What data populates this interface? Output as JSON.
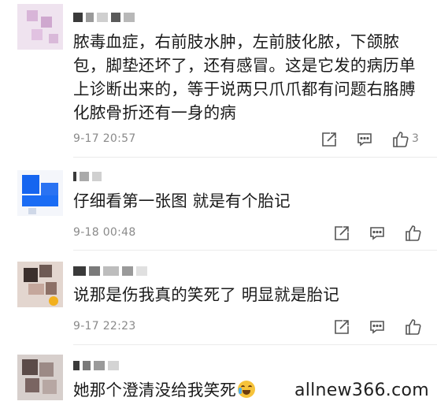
{
  "comments": [
    {
      "text": "脓毒血症，右前肢水肿，左前肢化脓，下颌脓包，脚垫还坏了，还有感冒。这是它发的病历单上诊断出来的，等于说两只爪爪都有问题右胳膊化脓骨折还有一身的病",
      "time": "9-17 20:57",
      "likes": "3"
    },
    {
      "text": "仔细看第一张图 就是有个胎记",
      "time": "9-18 00:48",
      "likes": ""
    },
    {
      "text": "说那是伤我真的笑死了 明显就是胎记",
      "time": "9-17 22:23",
      "likes": ""
    },
    {
      "text": "她那个澄清没给我笑死",
      "time": "",
      "likes": ""
    }
  ],
  "icons": {
    "share": "share-icon",
    "reply": "reply-icon",
    "like": "thumbs-up-icon"
  },
  "watermark": "allnew366.com",
  "colors": {
    "text": "#1a1a1a",
    "meta": "#8a8a8a",
    "icon": "#555555"
  }
}
